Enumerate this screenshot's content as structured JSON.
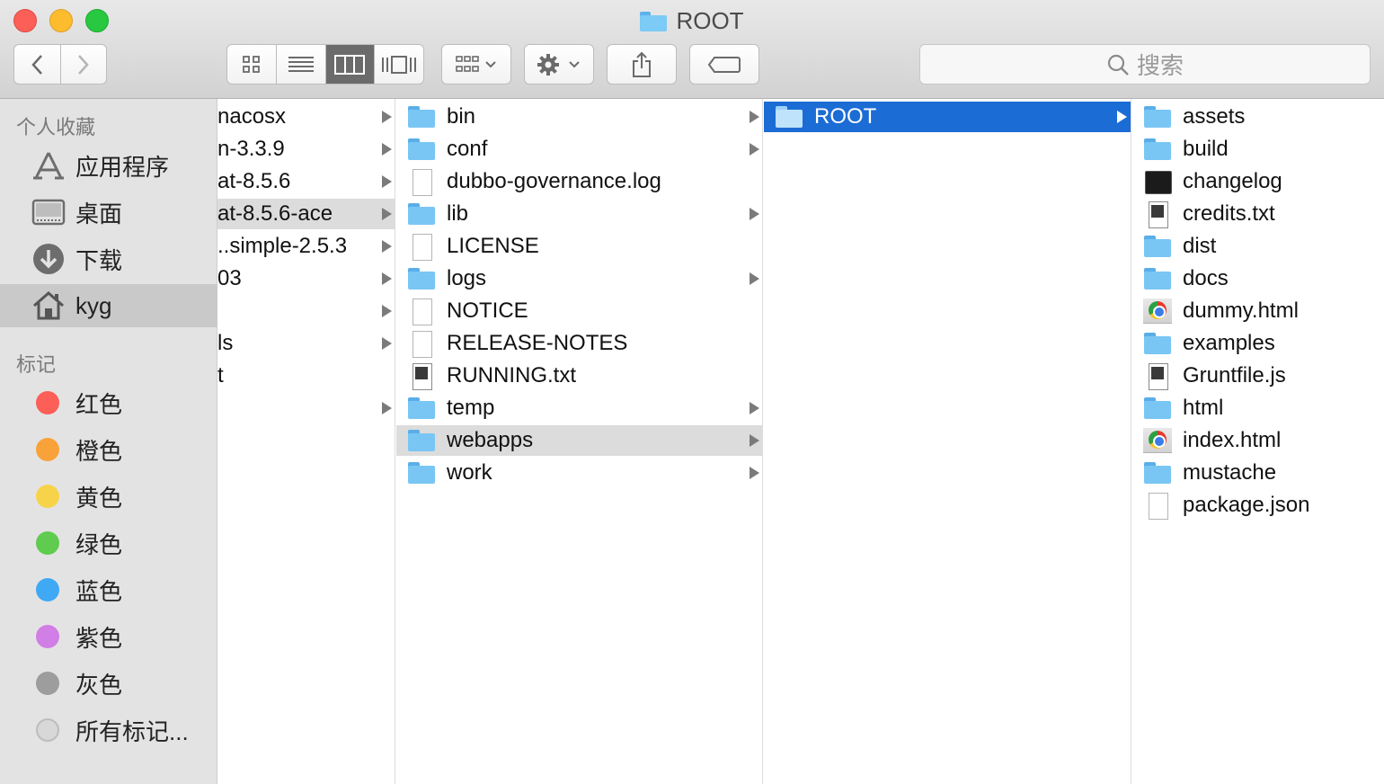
{
  "window": {
    "title": "ROOT"
  },
  "toolbar": {
    "search_placeholder": "搜索"
  },
  "sidebar": {
    "favorites_header": "个人收藏",
    "favorites": [
      {
        "label": "应用程序",
        "icon": "applications-icon"
      },
      {
        "label": "桌面",
        "icon": "desktop-icon"
      },
      {
        "label": "下载",
        "icon": "downloads-icon"
      },
      {
        "label": "kyg",
        "icon": "home-icon",
        "selected": true
      }
    ],
    "tags_header": "标记",
    "tags": [
      {
        "label": "红色",
        "color": "#fc5f57"
      },
      {
        "label": "橙色",
        "color": "#f9a23a"
      },
      {
        "label": "黄色",
        "color": "#f7d34a"
      },
      {
        "label": "绿色",
        "color": "#5fcb4f"
      },
      {
        "label": "蓝色",
        "color": "#3fa9f5"
      },
      {
        "label": "紫色",
        "color": "#d17ee6"
      },
      {
        "label": "灰色",
        "color": "#9d9d9d"
      },
      {
        "label": "所有标记...",
        "color": "#d8d8d8"
      }
    ]
  },
  "columns": {
    "col1": [
      {
        "label": "nacosx"
      },
      {
        "label": "n-3.3.9"
      },
      {
        "label": "at-8.5.6"
      },
      {
        "label": "at-8.5.6-ace"
      },
      {
        "label": "..simple-2.5.3"
      },
      {
        "label": "03"
      },
      {
        "label": ""
      },
      {
        "label": "ls"
      },
      {
        "label": "t"
      },
      {
        "label": ""
      }
    ],
    "col2": [
      {
        "label": "bin",
        "type": "folder"
      },
      {
        "label": "conf",
        "type": "folder"
      },
      {
        "label": "dubbo-governance.log",
        "type": "doc"
      },
      {
        "label": "lib",
        "type": "folder"
      },
      {
        "label": "LICENSE",
        "type": "doc"
      },
      {
        "label": "logs",
        "type": "folder"
      },
      {
        "label": "NOTICE",
        "type": "doc"
      },
      {
        "label": "RELEASE-NOTES",
        "type": "doc"
      },
      {
        "label": "RUNNING.txt",
        "type": "txt"
      },
      {
        "label": "temp",
        "type": "folder"
      },
      {
        "label": "webapps",
        "type": "folder"
      },
      {
        "label": "work",
        "type": "folder"
      }
    ],
    "col3": [
      {
        "label": "ROOT",
        "type": "folder"
      }
    ],
    "col4": [
      {
        "label": "assets",
        "type": "folder"
      },
      {
        "label": "build",
        "type": "folder"
      },
      {
        "label": "changelog",
        "type": "term"
      },
      {
        "label": "credits.txt",
        "type": "txt"
      },
      {
        "label": "dist",
        "type": "folder"
      },
      {
        "label": "docs",
        "type": "folder"
      },
      {
        "label": "dummy.html",
        "type": "chrome"
      },
      {
        "label": "examples",
        "type": "folder"
      },
      {
        "label": "Gruntfile.js",
        "type": "txt"
      },
      {
        "label": "html",
        "type": "folder"
      },
      {
        "label": "index.html",
        "type": "chrome"
      },
      {
        "label": "mustache",
        "type": "folder"
      },
      {
        "label": "package.json",
        "type": "doc"
      }
    ]
  }
}
